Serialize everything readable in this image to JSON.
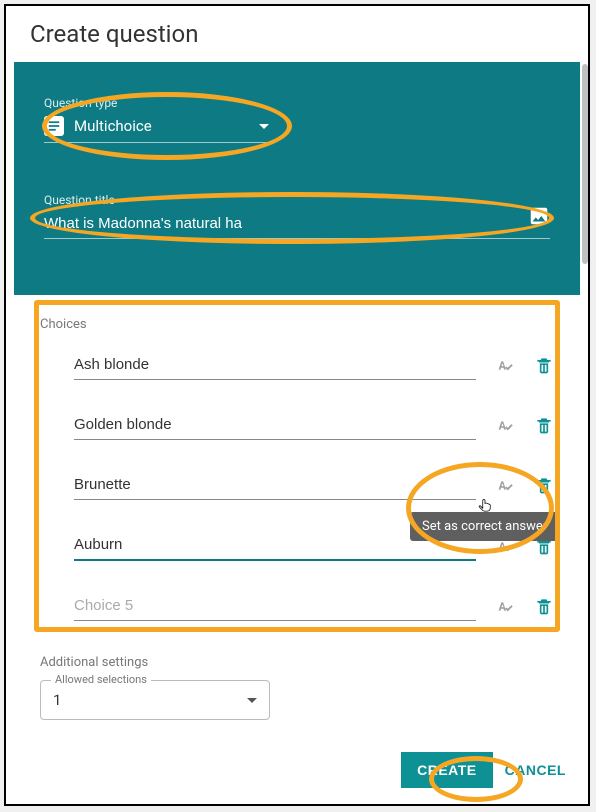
{
  "dialog": {
    "title": "Create question"
  },
  "questionType": {
    "label": "Question type",
    "value": "Multichoice"
  },
  "questionTitle": {
    "label": "Question title",
    "value": "What is Madonna's natural hair colour?"
  },
  "choices": {
    "label": "Choices",
    "items": [
      {
        "value": "Ash blonde",
        "placeholder": "",
        "active": false
      },
      {
        "value": "Golden blonde",
        "placeholder": "",
        "active": false
      },
      {
        "value": "Brunette",
        "placeholder": "",
        "active": false
      },
      {
        "value": "Auburn",
        "placeholder": "",
        "active": true
      },
      {
        "value": "",
        "placeholder": "Choice 5",
        "active": false
      }
    ]
  },
  "tooltip": "Set as correct answer",
  "additionalSettings": {
    "label": "Additional settings",
    "allowedSelections": {
      "label": "Allowed selections",
      "value": "1"
    }
  },
  "footer": {
    "create": "CREATE",
    "cancel": "CANCEL"
  }
}
